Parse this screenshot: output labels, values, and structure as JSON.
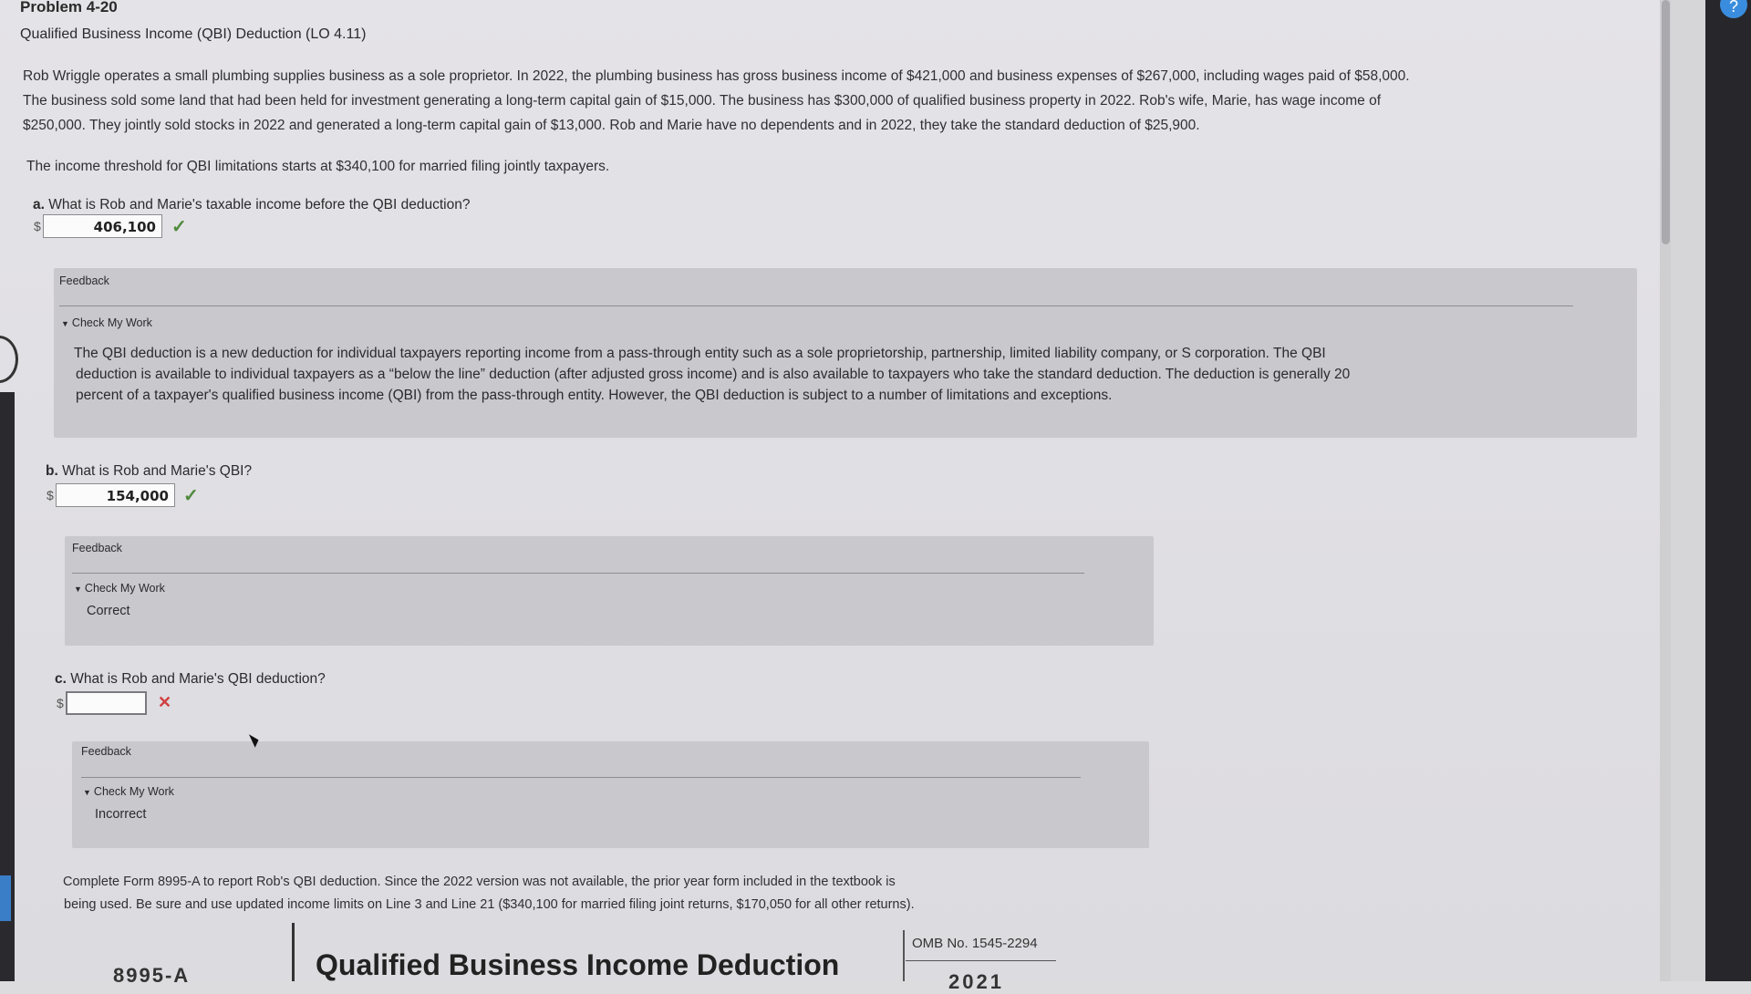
{
  "header": {
    "problem": "Problem 4-20",
    "subtitle": "Qualified Business Income (QBI) Deduction (LO 4.11)"
  },
  "scenario": {
    "line1": "Rob Wriggle operates a small plumbing supplies business as a sole proprietor. In 2022, the plumbing business has gross business income of $421,000 and business expenses of $267,000, including wages paid of $58,000.",
    "line2": "The business sold some land that had been held for investment generating a long-term capital gain of $15,000. The business has $300,000 of qualified business property in 2022. Rob's wife, Marie, has wage income of",
    "line3": "$250,000. They jointly sold stocks in 2022 and generated a long-term capital gain of $13,000. Rob and Marie have no dependents and in 2022, they take the standard deduction of $25,900.",
    "threshold": "The income threshold for QBI limitations starts at $340,100 for married filing jointly taxpayers."
  },
  "questions": {
    "a": {
      "letter": "a.",
      "text": "What is Rob and Marie's taxable income before the QBI deduction?",
      "currency": "$",
      "answer": "406,100",
      "status_icon": "check-icon",
      "feedback": {
        "label": "Feedback",
        "check_my_work": "Check My Work",
        "line1": "The QBI deduction is a new deduction for individual taxpayers reporting income from a pass-through entity such as a sole proprietorship, partnership, limited liability company, or S corporation. The QBI",
        "line2": "deduction is available to individual taxpayers as a “below the line” deduction (after adjusted gross income) and is also available to taxpayers who take the standard deduction. The deduction is generally 20",
        "line3": "percent of a taxpayer's qualified business income (QBI) from the pass-through entity. However, the QBI deduction is subject to a number of limitations and exceptions."
      }
    },
    "b": {
      "letter": "b.",
      "text": "What is Rob and Marie's QBI?",
      "currency": "$",
      "answer": "154,000",
      "status_icon": "check-icon",
      "feedback": {
        "label": "Feedback",
        "check_my_work": "Check My Work",
        "result": "Correct"
      }
    },
    "c": {
      "letter": "c.",
      "text": "What is Rob and Marie's QBI deduction?",
      "currency": "$",
      "answer": "",
      "status_icon": "x-icon",
      "feedback": {
        "label": "Feedback",
        "check_my_work": "Check My Work",
        "result": "Incorrect"
      }
    }
  },
  "form_instructions": {
    "line1": "Complete Form 8995-A to report Rob's QBI deduction. Since the 2022 version was not available, the prior year form included in the textbook is",
    "line2": "being used. Be sure and use updated income limits on Line 3 and Line 21 ($340,100 for married filing joint returns, $170,050 for all other returns)."
  },
  "form": {
    "number": "8995-A",
    "title": "Qualified Business Income Deduction",
    "omb": "OMB No. 1545-2294",
    "year": "2021"
  },
  "colors": {
    "check": "#4e8a3c",
    "x": "#d04040",
    "feedback_bg": "#c9c8cd"
  }
}
